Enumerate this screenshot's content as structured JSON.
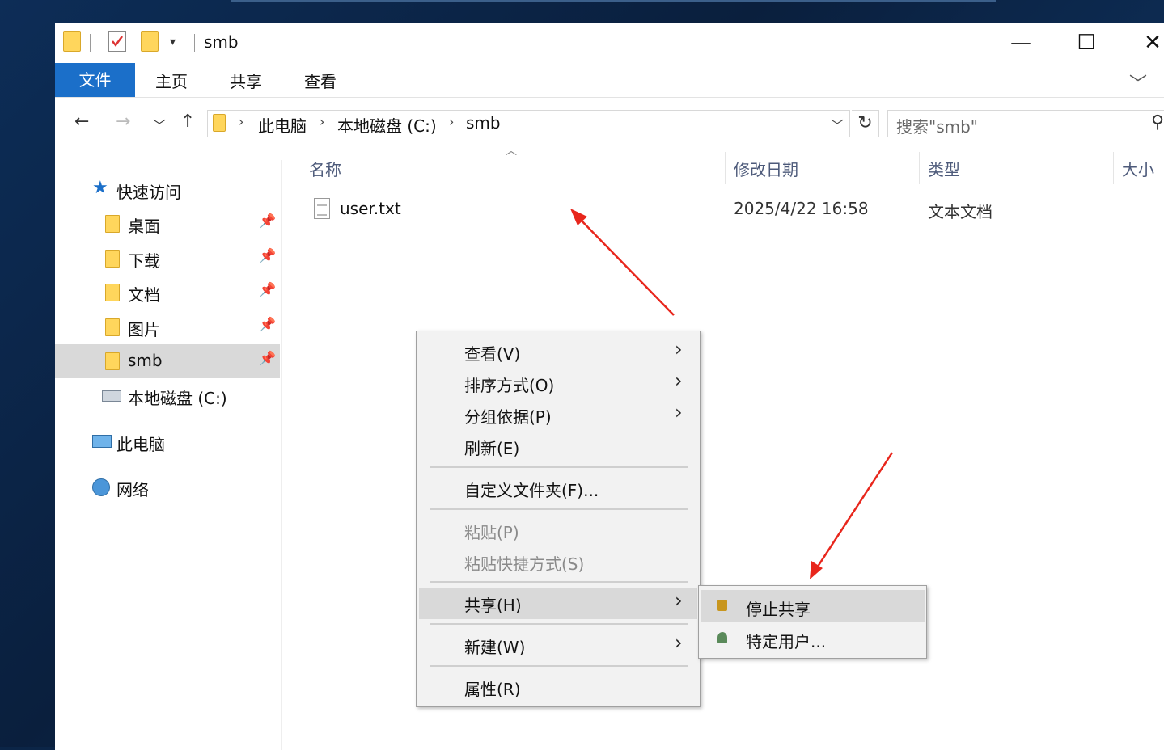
{
  "window": {
    "title": "smb",
    "controls": {
      "minimize": "—",
      "maximize": "☐",
      "close": "✕"
    }
  },
  "ribbon": {
    "tabs": [
      "文件",
      "主页",
      "共享",
      "查看"
    ]
  },
  "address": {
    "crumbs": [
      "此电脑",
      "本地磁盘 (C:)",
      "smb"
    ],
    "search_placeholder": "搜索\"smb\""
  },
  "sidebar": {
    "quick_access": "快速访问",
    "items": [
      "桌面",
      "下载",
      "文档",
      "图片",
      "smb",
      "本地磁盘 (C:)"
    ],
    "this_pc": "此电脑",
    "network": "网络",
    "selected": "smb"
  },
  "columns": {
    "name": "名称",
    "modified": "修改日期",
    "type": "类型",
    "size": "大小"
  },
  "files": [
    {
      "name": "user.txt",
      "modified": "2025/4/22 16:58",
      "type": "文本文档"
    }
  ],
  "context_menu": {
    "view": "查看(V)",
    "sort": "排序方式(O)",
    "group": "分组依据(P)",
    "refresh": "刷新(E)",
    "customize": "自定义文件夹(F)...",
    "paste": "粘贴(P)",
    "paste_shortcut": "粘贴快捷方式(S)",
    "share": "共享(H)",
    "new": "新建(W)",
    "properties": "属性(R)"
  },
  "share_submenu": {
    "stop_sharing": "停止共享",
    "specific_users": "特定用户..."
  },
  "colors": {
    "accent": "#1b6fc9",
    "annotation": "#e8261c",
    "menu_bg": "#f2f2f2",
    "highlight": "#d9d9d9"
  }
}
